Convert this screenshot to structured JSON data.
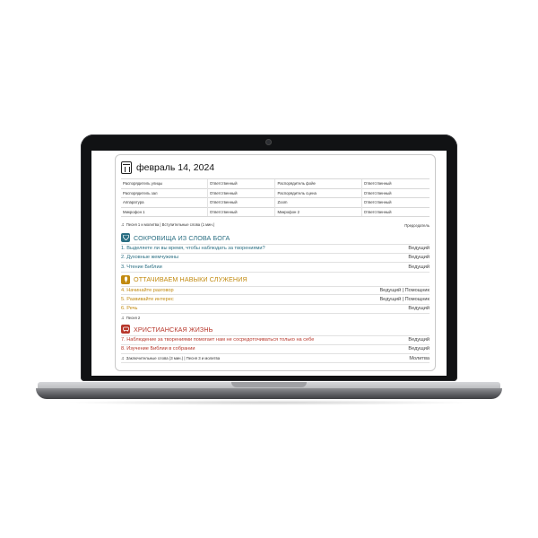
{
  "date": "февраль 14, 2024",
  "duties": [
    {
      "l1": "Распорядитель улицы",
      "v1": "Ответственный",
      "l2": "Распорядитель фойе",
      "v2": "Ответственный"
    },
    {
      "l1": "Распорядитель зал",
      "v1": "Ответственный",
      "l2": "Распорядитель сцена",
      "v2": "Ответственный"
    },
    {
      "l1": "Аппаратура",
      "v1": "Ответственный",
      "l2": "Zoom",
      "v2": "Ответственный"
    },
    {
      "l1": "Микрофон 1",
      "v1": "Ответственный",
      "l2": "Микрофон 2",
      "v2": "Ответственный"
    }
  ],
  "opening": {
    "text": "Песня 1 и молитва | Вступительные слова (1 мин.)",
    "who": "Председатель"
  },
  "sections": [
    {
      "title": "СОКРОВИЩА ИЗ СЛОВА БОГА",
      "color": "#2b6f83",
      "icon": "gem-icon",
      "items": [
        {
          "text": "1. Выделяете ли вы время, чтобы наблюдать за творениями?",
          "who": "Ведущий"
        },
        {
          "text": "2. Духовные жемчужины",
          "who": "Ведущий"
        },
        {
          "text": "3. Чтение Библии",
          "who": "Ведущий"
        }
      ]
    },
    {
      "title": "ОТТАЧИВАЕМ НАВЫКИ СЛУЖЕНИЯ",
      "color": "#c28a0f",
      "icon": "wheat-icon",
      "items": [
        {
          "text": "4. Начинайте разговор",
          "who": "Ведущий | Помощник"
        },
        {
          "text": "5. Развивайте интерес",
          "who": "Ведущий | Помощник"
        },
        {
          "text": "6. Речь",
          "who": "Ведущий"
        }
      ]
    },
    {
      "title": "ХРИСТИАНСКАЯ ЖИЗНЬ",
      "color": "#b7372b",
      "icon": "sheep-icon",
      "items": [
        {
          "text": "7. Наблюдение за творениями помогает нам не сосредоточиваться только на себе",
          "who": "Ведущий"
        },
        {
          "text": "8. Изучение Библии в собрании",
          "who": "Ведущий"
        }
      ]
    }
  ],
  "song2": "Песня 2",
  "closing": {
    "text": "Заключительные слова (3 мин.) | Песня 3 и молитва",
    "who": "Молитва"
  }
}
